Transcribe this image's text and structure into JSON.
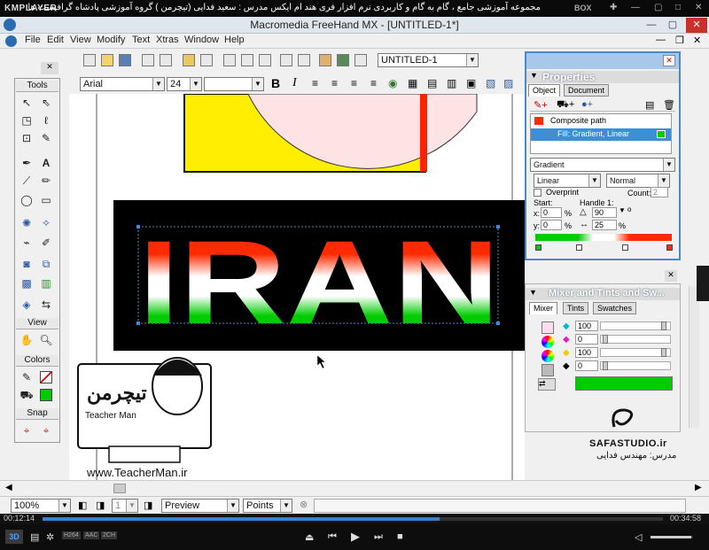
{
  "player": {
    "logo": "KMPLAYER",
    "title": "مجموعه آموزشی جامع ، گام به گام و کاربردی نرم افزار فری هند ام ایکس  مدرس : سعید فدایی (تیچرمن ) گروه آموزشی پادشاه گرافیست ها",
    "box_label": "BOX",
    "time_elapsed": "00:12:14",
    "time_total": "00:34:58",
    "progress_fraction": 0.64,
    "volume_fraction": 0.95,
    "codec_badges": [
      "H264",
      "AAC",
      "2CH"
    ]
  },
  "app": {
    "title": "Macromedia FreeHand MX - [UNTITLED-1*]",
    "menu": [
      "File",
      "Edit",
      "View",
      "Modify",
      "Text",
      "Xtras",
      "Window",
      "Help"
    ]
  },
  "toolbar": {
    "document_name": "UNTITLED-1",
    "font_name": "Arial",
    "font_size": "24",
    "bold_label": "B",
    "italic_label": "I"
  },
  "tools_panel": {
    "title": "Tools",
    "view_label": "View",
    "colors_label": "Colors",
    "snap_label": "Snap"
  },
  "canvas": {
    "word": "IRAN",
    "watermark_site": "www.TeacherMan.ir",
    "watermark_name": "Teacher Man",
    "studio": "SAFASTUDIO.ir",
    "teacher_fa": "مدرس: مهندس فدایی"
  },
  "properties": {
    "title": "Properties",
    "tabs": [
      "Object",
      "Document"
    ],
    "item_path": "Composite path",
    "item_fill": "Fill: Gradient, Linear",
    "fill_type": "Gradient",
    "gradient_kind": "Linear",
    "blend_mode": "Normal",
    "overprint_label": "Overprint",
    "count_label": "Count:",
    "count_value": "2",
    "start_label": "Start:",
    "handle_label": "Handle 1:",
    "x_label": "x:",
    "x_value": "0",
    "y_label": "y:",
    "y_value": "0",
    "angle_value": "90",
    "length_value": "25",
    "pct": "%",
    "deg": "o"
  },
  "mixer": {
    "title": "Mixer and Tints and Sw...",
    "tabs": [
      "Mixer",
      "Tints",
      "Swatches"
    ],
    "cyan": "100",
    "magenta": "0",
    "yellow": "100",
    "black": "0"
  },
  "status": {
    "zoom": "100%",
    "page_number": "1",
    "preview_mode": "Preview",
    "units": "Points"
  },
  "colors": {
    "red": "#ff2a00",
    "green": "#00cc00",
    "yellow": "#ffee00",
    "selection": "#3b8fd9"
  }
}
